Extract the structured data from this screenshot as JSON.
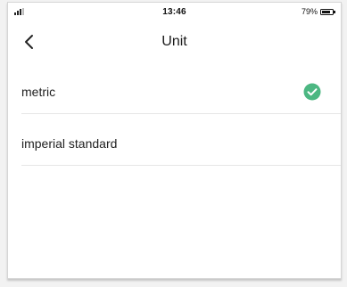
{
  "status_bar": {
    "time": "13:46",
    "battery_percent": "79%",
    "battery_level": 0.79,
    "signal_icon": "signal-bars-icon",
    "battery_icon": "battery-icon"
  },
  "header": {
    "title": "Unit",
    "back_icon": "chevron-left-icon"
  },
  "units": {
    "options": [
      {
        "label": "metric",
        "selected": true
      },
      {
        "label": "imperial standard",
        "selected": false
      }
    ],
    "check_icon": "check-circle-icon",
    "accent_color": "#4cb782"
  }
}
